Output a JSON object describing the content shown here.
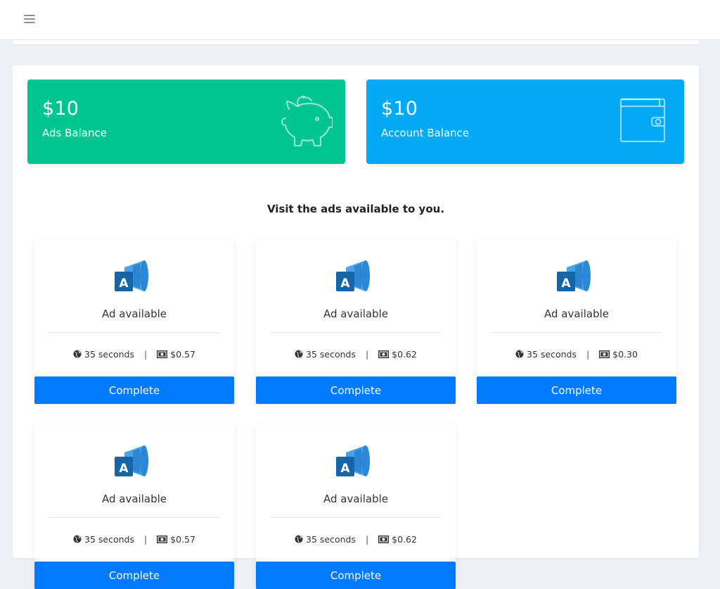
{
  "header": {
    "menu_icon": "hamburger-icon"
  },
  "balances": [
    {
      "amount": "$10",
      "label": "Ads Balance",
      "icon": "piggy-bank-icon",
      "color": "#00c58e"
    },
    {
      "amount": "$10",
      "label": "Account Balance",
      "icon": "wallet-icon",
      "color": "#03a9f4"
    }
  ],
  "heading": "Visit the ads available to you.",
  "ads": [
    {
      "title": "Ad available",
      "duration": "35 seconds",
      "reward": "$0.57",
      "button": "Complete"
    },
    {
      "title": "Ad available",
      "duration": "35 seconds",
      "reward": "$0.62",
      "button": "Complete"
    },
    {
      "title": "Ad available",
      "duration": "35 seconds",
      "reward": "$0.30",
      "button": "Complete"
    },
    {
      "title": "Ad available",
      "duration": "35 seconds",
      "reward": "$0.57",
      "button": "Complete"
    },
    {
      "title": "Ad available",
      "duration": "35 seconds",
      "reward": "$0.62",
      "button": "Complete"
    }
  ],
  "meta_separator": "|",
  "colors": {
    "button": "#007bff",
    "page_bg": "#eef0f5"
  }
}
